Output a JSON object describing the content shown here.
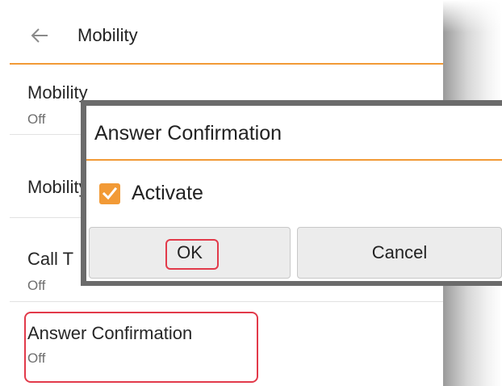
{
  "header": {
    "title": "Mobility",
    "back_icon": "arrow-left-icon"
  },
  "settings": [
    {
      "label": "Mobility",
      "value": "Off"
    },
    {
      "label": "Mobility",
      "value": ""
    },
    {
      "label": "Call T",
      "value": "Off"
    },
    {
      "label": "Answer Confirmation",
      "value": "Off"
    }
  ],
  "dialog": {
    "title": "Answer Confirmation",
    "checkbox_label": "Activate",
    "checkbox_checked": true,
    "ok_label": "OK",
    "cancel_label": "Cancel"
  },
  "colors": {
    "accent": "#f29a36",
    "highlight": "#e23a4a"
  }
}
